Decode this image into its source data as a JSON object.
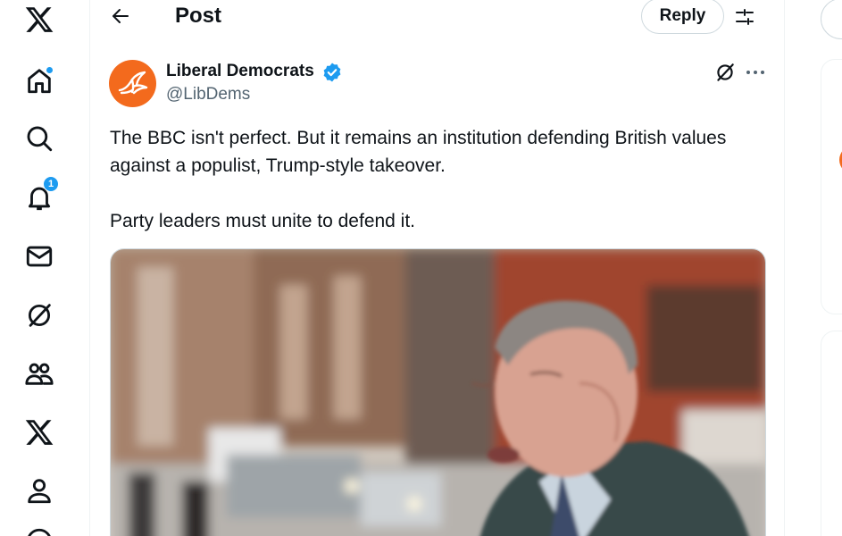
{
  "nav": {
    "notifications_count": "1",
    "accent_color": "#1d9bf0"
  },
  "header": {
    "title": "Post",
    "reply_label": "Reply"
  },
  "post": {
    "author_name": "Liberal Democrats",
    "author_handle": "@LibDems",
    "avatar_color": "#f36a1d",
    "lines": [
      "The BBC isn't perfect. But it remains an institution defending British values against a populist, Trump-style takeover.",
      "Party leaders must unite to defend it."
    ]
  }
}
